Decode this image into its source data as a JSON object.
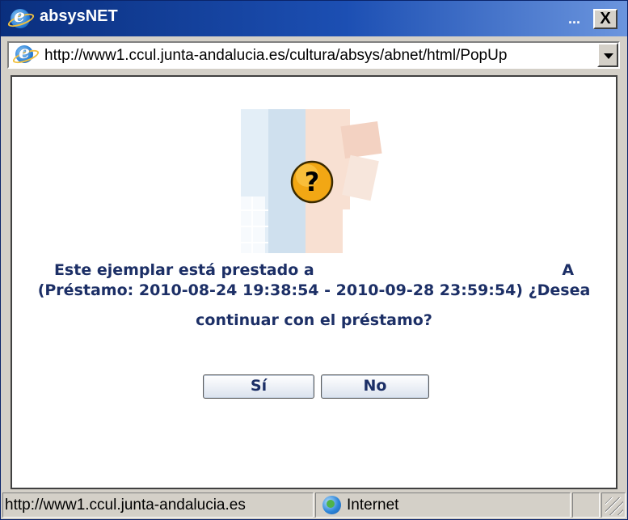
{
  "window": {
    "title": "absysNET",
    "title_dots": "...",
    "close_glyph": "X"
  },
  "address_bar": {
    "url": "http://www1.ccul.junta-andalucia.es/cultura/absys/abnet/html/PopUp"
  },
  "dialog": {
    "icon": "question-mark-icon",
    "icon_glyph": "?",
    "message_line1_prefix": "Este ejemplar está prestado a",
    "message_line1_suffix": "A",
    "message_line2": "(Préstamo: 2010-08-24 19:38:54 - 2010-09-28 23:59:54) ¿Desea",
    "message_line3": "continuar con el préstamo?",
    "yes_label": "Sí",
    "no_label": "No"
  },
  "status_bar": {
    "url_text": "http://www1.ccul.junta-andalucia.es",
    "zone_label": "Internet"
  },
  "colors": {
    "title_bar": "#0a2f7e",
    "message_text": "#1c2f66",
    "icon_fill": "#f2a714"
  }
}
